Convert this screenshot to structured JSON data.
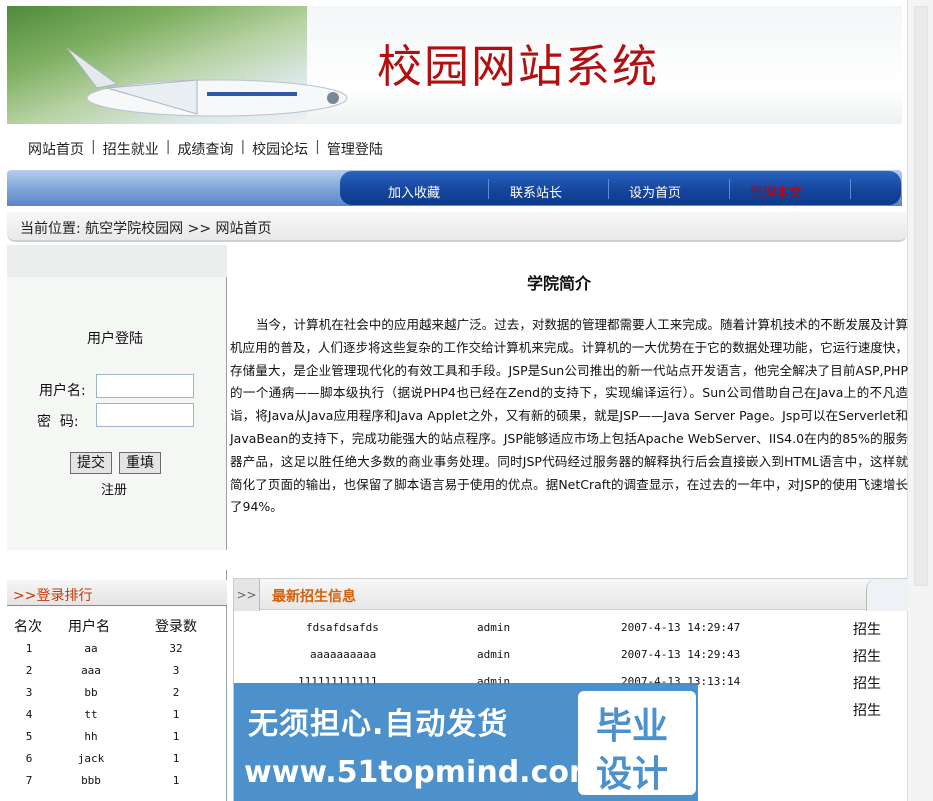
{
  "site_title": "校园网站系统",
  "nav": {
    "items": [
      "网站首页",
      "招生就业",
      "成绩查询",
      "校园论坛",
      "管理登陆"
    ],
    "separator": "|"
  },
  "bluebar": {
    "links": [
      "加入收藏",
      "联系站长",
      "设为首页",
      "管理本文"
    ],
    "highlight_color": "#c40000"
  },
  "breadcrumb": "当前位置: 航空学院校园网 >> 网站首页",
  "login": {
    "title": "用户登陆",
    "username_label": "用户名:",
    "password_label": "密  码:",
    "submit_label": "提交",
    "reset_label": "重填",
    "register_label": "注册",
    "username_value": "",
    "password_value": ""
  },
  "intro": {
    "title": "学院简介",
    "text": "当今，计算机在社会中的应用越来越广泛。过去，对数据的管理都需要人工来完成。随着计算机技术的不断发展及计算机应用的普及，人们逐步将这些复杂的工作交给计算机来完成。计算机的一大优势在于它的数据处理功能，它运行速度快，存储量大，是企业管理现代化的有效工具和手段。JSP是Sun公司推出的新一代站点开发语言，他完全解决了目前ASP,PHP的一个通病——脚本级执行（据说PHP4也已经在Zend的支持下，实现编译运行）。Sun公司借助自己在Java上的不凡造诣，将Java从Java应用程序和Java Applet之外，又有新的硕果，就是JSP——Java Server Page。Jsp可以在Serverlet和JavaBean的支持下，完成功能强大的站点程序。JSP能够适应市场上包括Apache WebServer、IIS4.0在内的85%的服务器产品，这足以胜任绝大多数的商业事务处理。同时JSP代码经过服务器的解释执行后会直接嵌入到HTML语言中，这样就简化了页面的输出，也保留了脚本语言易于使用的优点。据NetCraft的调查显示，在过去的一年中，对JSP的使用飞速增长了94%。"
  },
  "ranking": {
    "title": ">>登录排行",
    "headers": [
      "名次",
      "用户名",
      "登录数"
    ],
    "rows": [
      {
        "rank": "1",
        "user": "aa",
        "count": "32"
      },
      {
        "rank": "2",
        "user": "aaa",
        "count": "3"
      },
      {
        "rank": "3",
        "user": "bb",
        "count": "2"
      },
      {
        "rank": "4",
        "user": "tt",
        "count": "1"
      },
      {
        "rank": "5",
        "user": "hh",
        "count": "1"
      },
      {
        "rank": "6",
        "user": "jack",
        "count": "1"
      },
      {
        "rank": "7",
        "user": "bbb",
        "count": "1"
      }
    ]
  },
  "recruit": {
    "arrows": ">>",
    "title": "最新招生信息",
    "rows": [
      {
        "title": "fdsafdsafds",
        "author": "admin",
        "date": "2007-4-13 14:29:47",
        "category": "招生"
      },
      {
        "title": "aaaaaaaaaa",
        "author": "admin",
        "date": "2007-4-13 14:29:43",
        "category": "招生"
      },
      {
        "title": "111111111111",
        "author": "admin",
        "date": "2007-4-13 13:13:14",
        "category": "招生"
      },
      {
        "title": "",
        "author": "",
        "date": "",
        "category": "招生"
      }
    ]
  },
  "watermark": {
    "line1": "无须担心.自动发货",
    "line2": "www.51topmind.com",
    "badge1": "毕业",
    "badge2": "设计"
  }
}
